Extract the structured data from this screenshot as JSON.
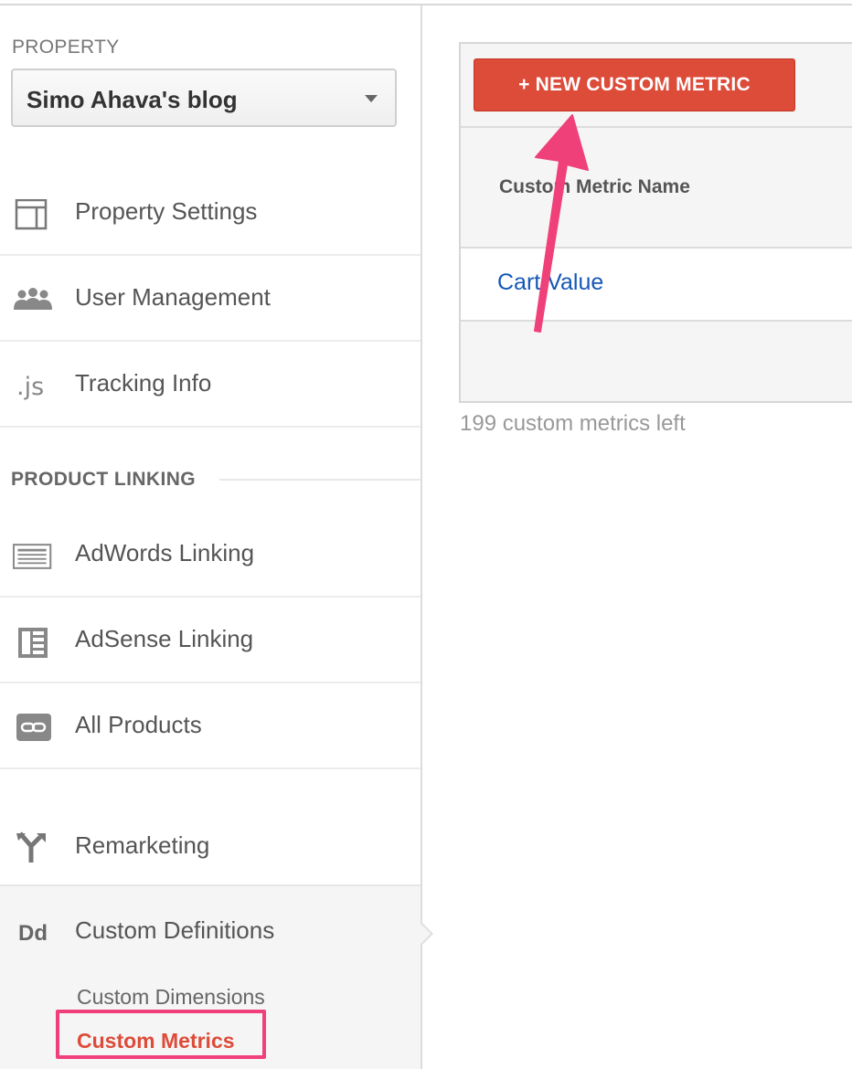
{
  "sidebar": {
    "property_label": "PROPERTY",
    "property_selected": "Simo Ahava's blog",
    "items": [
      {
        "label": "Property Settings",
        "icon": "layout-icon"
      },
      {
        "label": "User Management",
        "icon": "users-icon"
      },
      {
        "label": "Tracking Info",
        "icon": "js-icon"
      }
    ],
    "product_linking_title": "PRODUCT LINKING",
    "linking_items": [
      {
        "label": "AdWords Linking",
        "icon": "adwords-icon"
      },
      {
        "label": "AdSense Linking",
        "icon": "adsense-icon"
      },
      {
        "label": "All Products",
        "icon": "link-icon"
      }
    ],
    "remarketing_label": "Remarketing",
    "custom_definitions": {
      "icon_text": "Dd",
      "label": "Custom Definitions",
      "sub_items": [
        "Custom Dimensions",
        "Custom Metrics"
      ],
      "active_sub_item": "Custom Metrics"
    }
  },
  "main": {
    "new_button_label": "+ NEW CUSTOM METRIC",
    "table": {
      "column_header": "Custom Metric Name",
      "rows": [
        "Cart Value"
      ]
    },
    "remaining_text": "199 custom metrics left"
  },
  "colors": {
    "accent_red": "#dd4b39",
    "link_blue": "#1558b7",
    "annotation_pink": "#f0407a"
  }
}
